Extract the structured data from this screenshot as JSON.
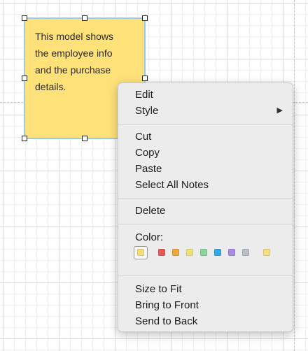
{
  "note": {
    "lines": [
      "This model shows",
      "the employee info",
      "and the purchase",
      "details."
    ],
    "fill_color": "#ffe17a",
    "selection_color": "#9cc9ea"
  },
  "context_menu": {
    "edit": "Edit",
    "style": "Style",
    "style_submenu_icon": "chevron-right-icon",
    "submenu_arrow": "▶",
    "cut": "Cut",
    "copy": "Copy",
    "paste": "Paste",
    "select_all_notes": "Select All Notes",
    "delete": "Delete",
    "color_label": "Color:",
    "colors": [
      {
        "name": "yellow",
        "hex": "#f7de7a",
        "selected": true
      },
      {
        "name": "red",
        "hex": "#e85a5a"
      },
      {
        "name": "orange",
        "hex": "#eaa83d"
      },
      {
        "name": "light-yellow",
        "hex": "#eee37a"
      },
      {
        "name": "green",
        "hex": "#8ad59a"
      },
      {
        "name": "blue",
        "hex": "#3aa8e6"
      },
      {
        "name": "purple",
        "hex": "#a98be5"
      },
      {
        "name": "gray",
        "hex": "#b8bfc6"
      },
      {
        "name": "pale-yellow",
        "hex": "#f5df7f"
      }
    ],
    "size_to_fit": "Size to Fit",
    "bring_to_front": "Bring to Front",
    "send_to_back": "Send to Back"
  }
}
